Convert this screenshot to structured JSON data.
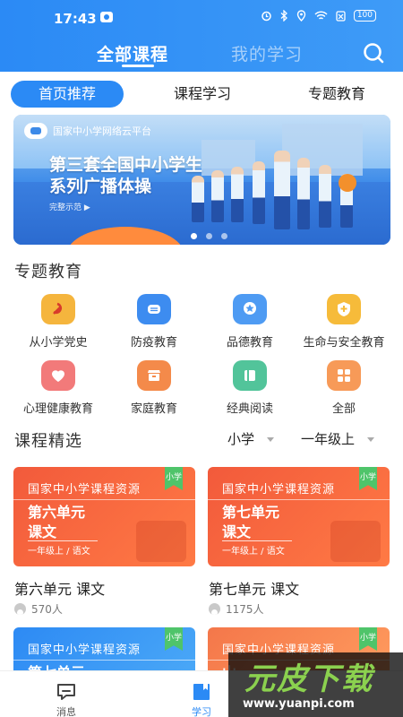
{
  "status_bar": {
    "time": "17:43",
    "battery": "100"
  },
  "header": {
    "tabs": [
      "全部课程",
      "我的学习"
    ],
    "active_tab": 0
  },
  "sub_tabs": [
    "首页推荐",
    "课程学习",
    "专题教育"
  ],
  "banner": {
    "logo_text": "国家中小学网络云平台",
    "title_line1": "第三套全国中小学生",
    "title_line2": "系列广播体操",
    "subtitle": "完整示范 ▶",
    "dots": 3,
    "active_dot": 0
  },
  "topic_section": {
    "title": "专题教育",
    "items": [
      {
        "label": "从小学党史",
        "icon": "party-emblem-icon",
        "color": "#f5b53d"
      },
      {
        "label": "防疫教育",
        "icon": "mask-icon",
        "color": "#3d8cf0"
      },
      {
        "label": "品德教育",
        "icon": "star-badge-icon",
        "color": "#4e9bf3"
      },
      {
        "label": "生命与安全教育",
        "icon": "shield-icon",
        "color": "#f6bb3a"
      },
      {
        "label": "心理健康教育",
        "icon": "heart-icon",
        "color": "#f27a7a"
      },
      {
        "label": "家庭教育",
        "icon": "home-box-icon",
        "color": "#f48a4a"
      },
      {
        "label": "经典阅读",
        "icon": "book-icon",
        "color": "#52c49a"
      },
      {
        "label": "全部",
        "icon": "grid-all-icon",
        "color": "#f79a58"
      }
    ]
  },
  "course_section": {
    "title": "课程精选",
    "filter_stage": "小学",
    "filter_grade": "一年级上"
  },
  "cards": [
    {
      "header": "国家中小学课程资源",
      "unit_line1": "第六单元",
      "unit_line2": "课文",
      "grade": "一年级上 / 语文",
      "tag": "小学",
      "name": "第六单元 课文",
      "count": "570人"
    },
    {
      "header": "国家中小学课程资源",
      "unit_line1": "第七单元",
      "unit_line2": "课文",
      "grade": "一年级上 / 语文",
      "tag": "小学",
      "name": "第七单元 课文",
      "count": "1175人"
    },
    {
      "header": "国家中小学课程资源",
      "unit_line1": "第七单元",
      "tag": "小学"
    },
    {
      "header": "国家中小学课程资源",
      "unit_line1": "山",
      "tag": "小学"
    }
  ],
  "bottom_nav": [
    {
      "label": "消息",
      "icon": "message-icon"
    },
    {
      "label": "学习",
      "icon": "study-icon"
    }
  ],
  "watermark": {
    "text": "元皮下载",
    "url": "www.yuanpi.com"
  }
}
